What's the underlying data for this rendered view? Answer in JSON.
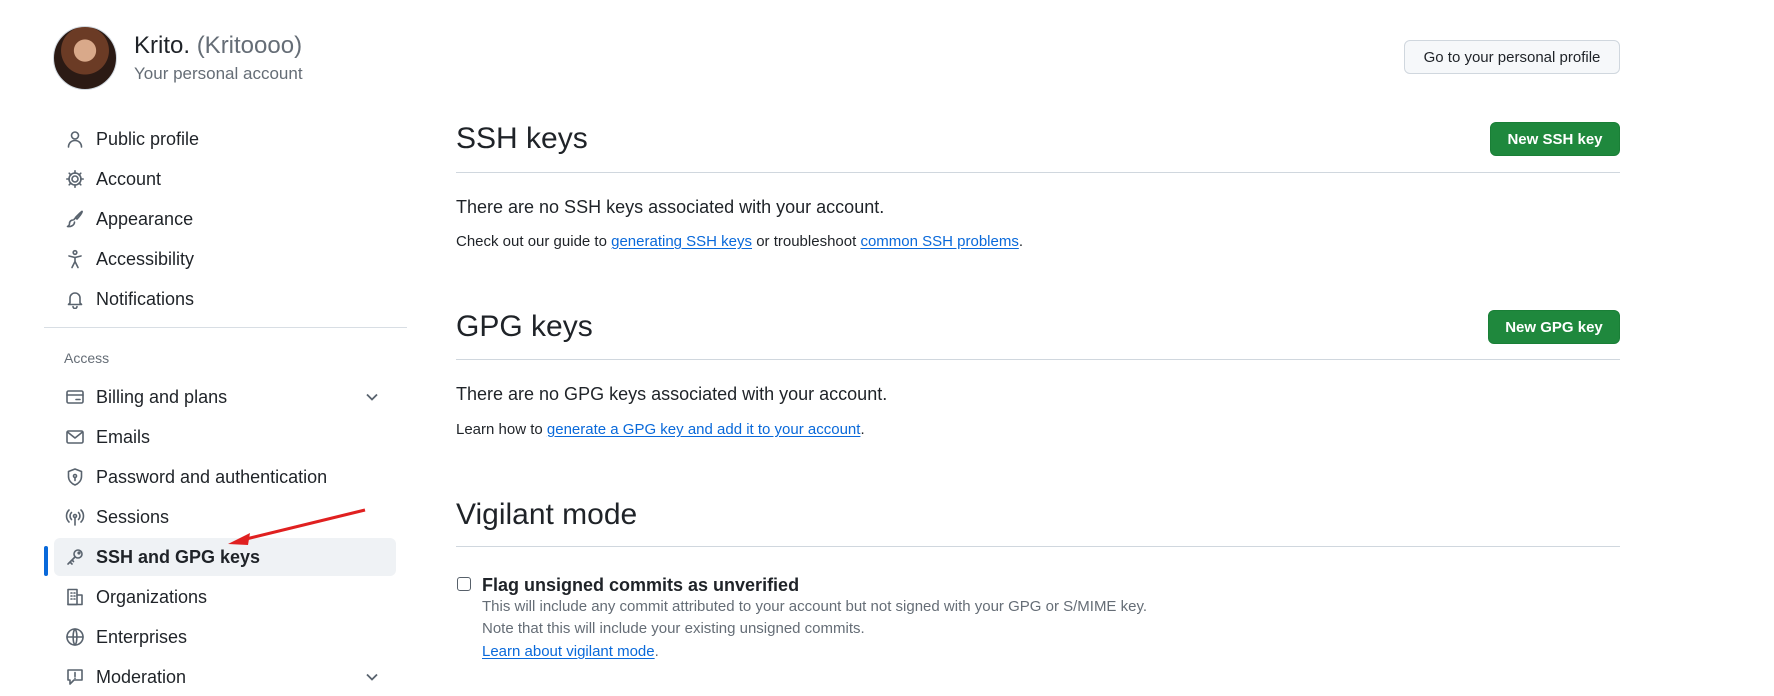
{
  "account": {
    "display_name": "Krito.",
    "handle": "(Kritoooo)",
    "subtitle": "Your personal account",
    "profile_button": "Go to your personal profile"
  },
  "sidebar": {
    "items": [
      {
        "label": "Public profile",
        "icon": "person-icon"
      },
      {
        "label": "Account",
        "icon": "gear-icon"
      },
      {
        "label": "Appearance",
        "icon": "paintbrush-icon"
      },
      {
        "label": "Accessibility",
        "icon": "accessibility-icon"
      },
      {
        "label": "Notifications",
        "icon": "bell-icon"
      }
    ],
    "group_access_label": "Access",
    "access_items": [
      {
        "label": "Billing and plans",
        "icon": "credit-card-icon",
        "expandable": true
      },
      {
        "label": "Emails",
        "icon": "mail-icon"
      },
      {
        "label": "Password and authentication",
        "icon": "shield-lock-icon"
      },
      {
        "label": "Sessions",
        "icon": "broadcast-icon"
      },
      {
        "label": "SSH and GPG keys",
        "icon": "key-icon",
        "active": true
      },
      {
        "label": "Organizations",
        "icon": "organization-icon"
      },
      {
        "label": "Enterprises",
        "icon": "globe-icon"
      },
      {
        "label": "Moderation",
        "icon": "report-icon",
        "expandable": true
      }
    ]
  },
  "ssh": {
    "title": "SSH keys",
    "new_button": "New SSH key",
    "empty_text": "There are no SSH keys associated with your account.",
    "help_prefix": "Check out our guide to",
    "help_link1": "generating SSH keys",
    "help_middle": "or troubleshoot",
    "help_link2": "common SSH problems",
    "help_suffix": "."
  },
  "gpg": {
    "title": "GPG keys",
    "new_button": "New GPG key",
    "empty_text": "There are no GPG keys associated with your account.",
    "help_prefix": "Learn how to",
    "help_link": "generate a GPG key and add it to your account",
    "help_suffix": "."
  },
  "vigilant": {
    "title": "Vigilant mode",
    "checkbox_label": "Flag unsigned commits as unverified",
    "checked": false,
    "note1": "This will include any commit attributed to your account but not signed with your GPG or S/MIME key.",
    "note2": "Note that this will include your existing unsigned commits.",
    "learn_link": "Learn about vigilant mode",
    "learn_suffix": "."
  },
  "colors": {
    "accent_blue": "#0969da",
    "primary_green": "#1f883d",
    "annotation_red": "#e02020"
  }
}
